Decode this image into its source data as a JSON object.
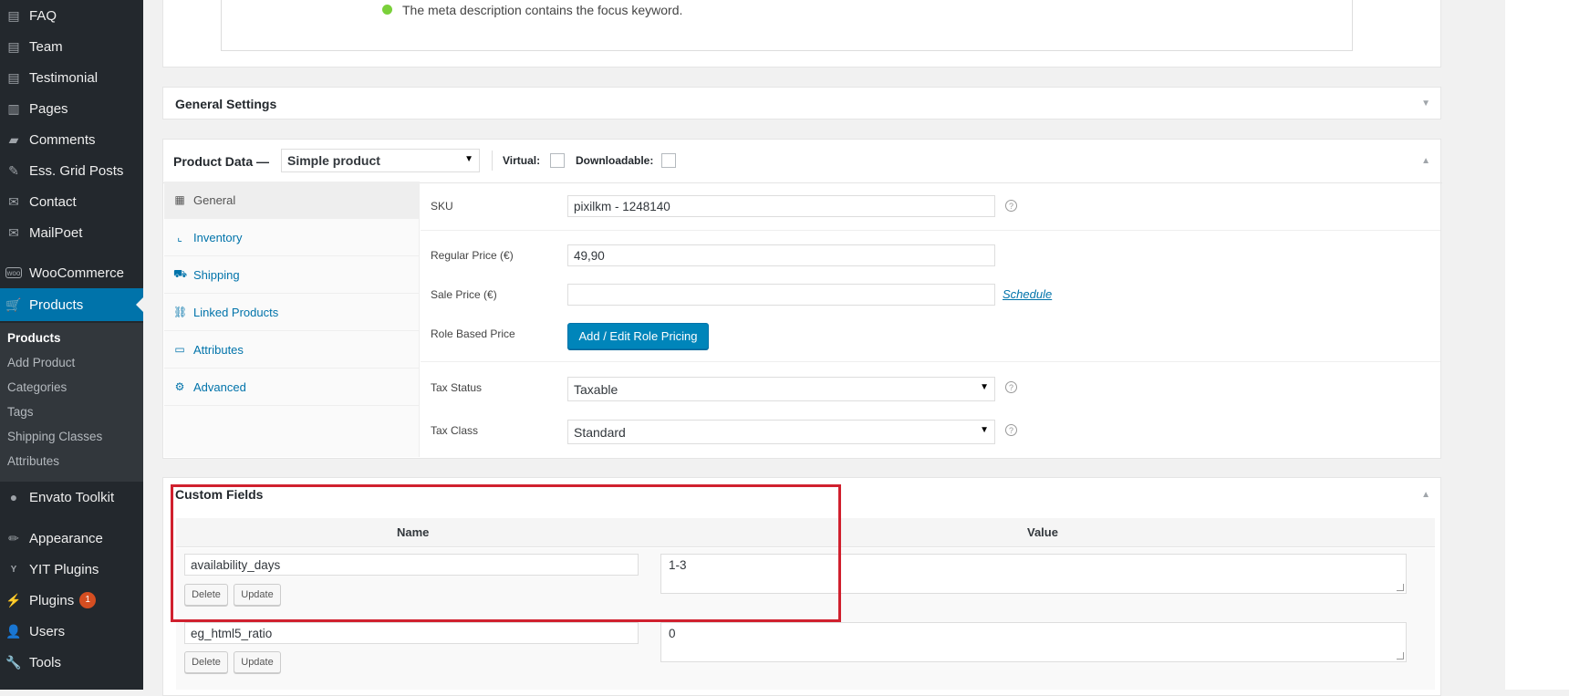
{
  "sidebar": {
    "items": [
      {
        "label": "FAQ",
        "icon": "page-icon"
      },
      {
        "label": "Team",
        "icon": "page-icon"
      },
      {
        "label": "Testimonial",
        "icon": "page-icon"
      },
      {
        "label": "Pages",
        "icon": "pages-icon"
      },
      {
        "label": "Comments",
        "icon": "comment-icon"
      },
      {
        "label": "Ess. Grid Posts",
        "icon": "pin-icon"
      },
      {
        "label": "Contact",
        "icon": "mail-icon"
      },
      {
        "label": "MailPoet",
        "icon": "mail-icon"
      },
      {
        "label": "WooCommerce",
        "icon": "woo-icon"
      },
      {
        "label": "Products",
        "icon": "cart-icon"
      },
      {
        "label": "Envato Toolkit",
        "icon": "leaf-icon"
      },
      {
        "label": "Appearance",
        "icon": "brush-icon"
      },
      {
        "label": "YIT Plugins",
        "icon": "yit-icon"
      },
      {
        "label": "Plugins",
        "icon": "plug-icon",
        "badge": "1"
      },
      {
        "label": "Users",
        "icon": "user-icon"
      },
      {
        "label": "Tools",
        "icon": "wrench-icon"
      }
    ],
    "submenu": [
      "Products",
      "Add Product",
      "Categories",
      "Tags",
      "Shipping Classes",
      "Attributes"
    ]
  },
  "seo": {
    "message": "The meta description contains the focus keyword."
  },
  "general_settings": {
    "title": "General Settings"
  },
  "product_data": {
    "title": "Product Data —",
    "type_select": "Simple product",
    "virtual_label": "Virtual:",
    "downloadable_label": "Downloadable:",
    "tabs": [
      {
        "label": "General",
        "icon": "gear-list-icon"
      },
      {
        "label": "Inventory",
        "icon": "chart-icon"
      },
      {
        "label": "Shipping",
        "icon": "truck-icon"
      },
      {
        "label": "Linked Products",
        "icon": "link-icon"
      },
      {
        "label": "Attributes",
        "icon": "list-icon"
      },
      {
        "label": "Advanced",
        "icon": "cog-icon"
      }
    ],
    "sku_label": "SKU",
    "sku_value": "pixilkm - 1248140",
    "regular_price_label": "Regular Price (€)",
    "regular_price_value": "49,90",
    "sale_price_label": "Sale Price (€)",
    "sale_price_value": "",
    "schedule_link": "Schedule",
    "role_price_label": "Role Based Price",
    "role_price_button": "Add / Edit Role Pricing",
    "tax_status_label": "Tax Status",
    "tax_status_value": "Taxable",
    "tax_class_label": "Tax Class",
    "tax_class_value": "Standard"
  },
  "custom_fields": {
    "title": "Custom Fields",
    "col_name": "Name",
    "col_value": "Value",
    "rows": [
      {
        "name": "availability_days",
        "value": "1-3"
      },
      {
        "name": "eg_html5_ratio",
        "value": "0"
      }
    ],
    "delete_label": "Delete",
    "update_label": "Update"
  },
  "colors": {
    "sidebar_bg": "#23282d",
    "active_menu": "#0073aa",
    "primary_button": "#0085ba",
    "highlight_border": "#d0202e",
    "status_dot": "#7ad03a"
  }
}
